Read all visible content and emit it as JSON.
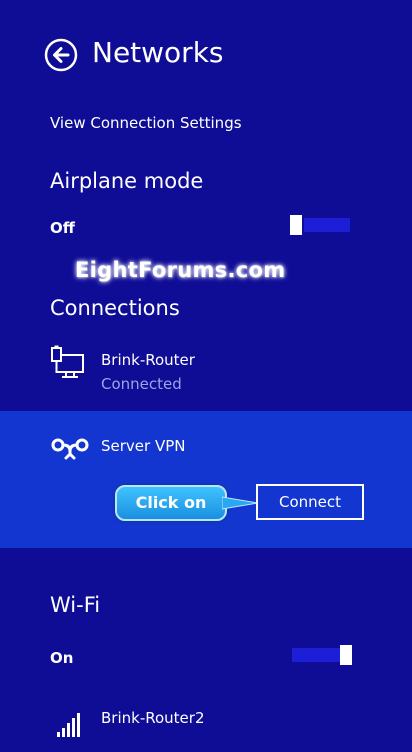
{
  "header": {
    "title": "Networks"
  },
  "links": {
    "view_connection_settings": "View Connection Settings"
  },
  "airplane": {
    "heading": "Airplane mode",
    "state": "Off"
  },
  "watermark": {
    "text": "EightForums.com"
  },
  "connections": {
    "heading": "Connections",
    "items": [
      {
        "name": "Brink-Router",
        "status": "Connected",
        "icon": "ethernet-icon"
      },
      {
        "name": "Server VPN",
        "icon": "vpn-icon",
        "action": "Connect"
      }
    ]
  },
  "callout": {
    "text": "Click on"
  },
  "wifi": {
    "heading": "Wi-Fi",
    "state": "On",
    "networks": [
      {
        "name": "Brink-Router2",
        "icon": "signal-icon"
      }
    ]
  },
  "colors": {
    "background": "#0f0c96",
    "selected_row": "#1436d0",
    "toggle_track": "#1c1fd6",
    "callout": "#2aa7f0"
  }
}
